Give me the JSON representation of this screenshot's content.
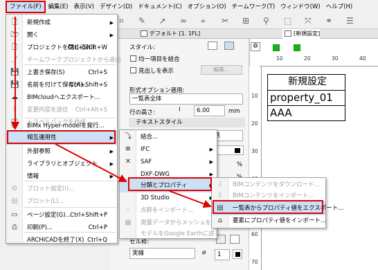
{
  "menubar": {
    "items": [
      "ファイル(F)",
      "編集(E)",
      "表示(V)",
      "デザイン(D)",
      "ドキュメント(C)",
      "オプション(O)",
      "チームワーク(T)",
      "ウィンドウ(W)",
      "ヘルプ(H)"
    ]
  },
  "tabs": {
    "floor": "デフォルト [1. 1FL]",
    "layout": "[新規設定]"
  },
  "panel": {
    "style_label": "スタイル:",
    "uniform_item": "均一項目を結合",
    "show_heading": "見出しを表示",
    "edit_button": "編集...",
    "format_options": "形式オプション適用:",
    "format_value": "一覧表全体",
    "row_height_label": "行の高さ:",
    "row_height_value": "6.00",
    "row_height_unit": "mm",
    "text_style": "テキストスタイル",
    "font_suffix": "語",
    "pct": "%",
    "cell_frame": "セル枠:",
    "line_type": "実線",
    "line_width": "1"
  },
  "ruler": {
    "top": [
      "10",
      "20",
      "30",
      "40"
    ],
    "left": [
      "10",
      "20",
      "30",
      "40",
      "50",
      "60",
      "70"
    ]
  },
  "label_table": {
    "header": "新規設定",
    "row1": "property_01",
    "row2": "AAA"
  },
  "file_menu": {
    "items": [
      {
        "label": "新規作成",
        "shortcut": "",
        "arrow": true,
        "icon": "new-file",
        "disabled": false
      },
      {
        "label": "開く",
        "shortcut": "",
        "arrow": true,
        "icon": "open-folder",
        "disabled": false
      },
      {
        "label": "プロジェクトを閉じる(C)",
        "shortcut": "Ctrl+Shift+W",
        "arrow": false,
        "icon": "close-project",
        "disabled": false
      },
      {
        "label": "チームワークプロジェクトから退出",
        "shortcut": "",
        "arrow": false,
        "icon": "teamwork-leave",
        "disabled": true
      },
      {
        "label": "上書き保存(S)",
        "shortcut": "Ctrl+S",
        "arrow": false,
        "icon": "save",
        "disabled": false
      },
      {
        "label": "名前を付けて保存(A)...",
        "shortcut": "Ctrl+Shift+S",
        "arrow": false,
        "icon": "save-as",
        "disabled": false
      },
      {
        "label": "BIMcloudへエクスポート...",
        "shortcut": "",
        "arrow": false,
        "icon": "bimcloud-export",
        "disabled": false
      },
      {
        "label": "変更内容を送信",
        "shortcut": "Ctrl+Alt+S",
        "arrow": false,
        "icon": "send-changes",
        "disabled": true
      },
      {
        "label": "トラベルパックを作成",
        "shortcut": "",
        "arrow": false,
        "icon": "travel-pack",
        "disabled": true
      },
      {
        "label": "BIMx Hyper-modelを発行...",
        "shortcut": "",
        "arrow": false,
        "icon": "bimx",
        "disabled": false
      },
      {
        "label": "相互運用性",
        "shortcut": "",
        "arrow": true,
        "icon": "",
        "disabled": false
      },
      {
        "label": "外部参照",
        "shortcut": "",
        "arrow": true,
        "icon": "",
        "disabled": false
      },
      {
        "label": "ライブラリとオブジェクト",
        "shortcut": "",
        "arrow": true,
        "icon": "",
        "disabled": false
      },
      {
        "label": "情報",
        "shortcut": "",
        "arrow": true,
        "icon": "",
        "disabled": false
      },
      {
        "label": "プロット設定(I)...",
        "shortcut": "",
        "arrow": false,
        "icon": "plot-settings",
        "disabled": true
      },
      {
        "label": "プロット(L)...",
        "shortcut": "",
        "arrow": false,
        "icon": "plot",
        "disabled": true
      },
      {
        "label": "ページ設定(G)...",
        "shortcut": "Ctrl+Shift+P",
        "arrow": false,
        "icon": "page-setup",
        "disabled": false
      },
      {
        "label": "印刷(P)...",
        "shortcut": "Ctrl+P",
        "arrow": false,
        "icon": "print",
        "disabled": false
      },
      {
        "label": "ARCHICADを終了(X)",
        "shortcut": "Ctrl+Q",
        "arrow": false,
        "icon": "",
        "disabled": false
      }
    ]
  },
  "interop_menu": {
    "items": [
      {
        "label": "結合...",
        "arrow": false,
        "icon": "merge",
        "disabled": false
      },
      {
        "label": "IFC",
        "arrow": true,
        "icon": "ifc",
        "disabled": false
      },
      {
        "label": "SAF",
        "arrow": true,
        "icon": "saf",
        "disabled": false
      },
      {
        "label": "DXF-DWG",
        "arrow": true,
        "icon": "",
        "disabled": false
      },
      {
        "label": "分類とプロパティ",
        "arrow": true,
        "icon": "",
        "disabled": false
      },
      {
        "label": "3D Studio",
        "arrow": true,
        "icon": "",
        "disabled": false
      },
      {
        "label": "点群をインポート...",
        "arrow": false,
        "icon": "point-cloud",
        "disabled": true
      },
      {
        "label": "測量データからメッシュを配置...",
        "arrow": false,
        "icon": "survey-mesh",
        "disabled": true
      },
      {
        "label": "モデルをGoogle Earthに送る",
        "arrow": false,
        "icon": "",
        "disabled": true
      }
    ]
  },
  "classprop_menu": {
    "items": [
      {
        "label": "BIMコンテンツをダウンロード...",
        "icon": "bim-download",
        "disabled": true
      },
      {
        "label": "BIMコンテンツをインポート...",
        "icon": "bim-import",
        "disabled": true
      },
      {
        "label": "一覧表からプロパティ値をエクスポート...",
        "icon": "schedule-export",
        "disabled": false
      },
      {
        "label": "要素にプロパティ値をインポート...",
        "icon": "property-import",
        "disabled": false
      }
    ]
  },
  "colors": {
    "highlight": "#cce0f6",
    "callout": "#e00000"
  }
}
